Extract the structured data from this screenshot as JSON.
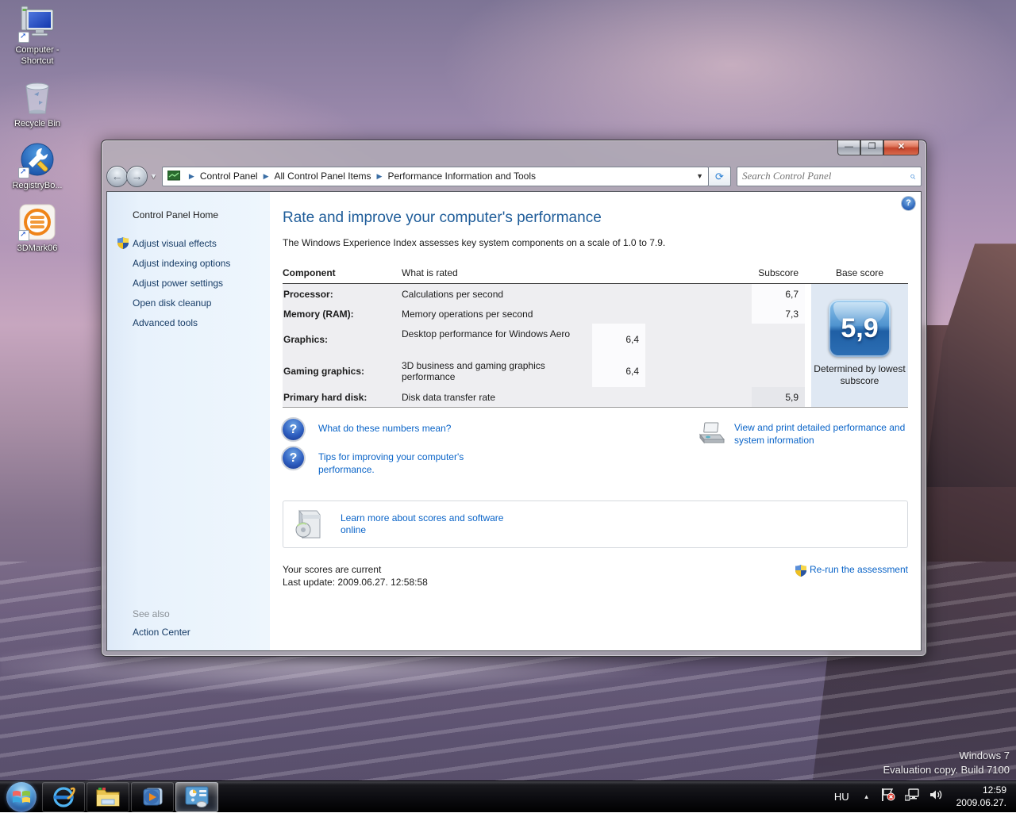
{
  "desktop": {
    "icons": [
      {
        "label": "Computer - Shortcut"
      },
      {
        "label": "Recycle Bin"
      },
      {
        "label": "RegistryBo..."
      },
      {
        "label": "3DMark06"
      }
    ],
    "watermark": {
      "line1": "Windows 7",
      "line2": "Evaluation copy. Build 7100"
    }
  },
  "window": {
    "caption_buttons": {
      "minimize": "—",
      "maximize": "❐",
      "close": "✕"
    },
    "breadcrumb": {
      "item1": "Control Panel",
      "item2": "All Control Panel Items",
      "item3": "Performance Information and Tools"
    },
    "search": {
      "placeholder": "Search Control Panel"
    },
    "sidebar": {
      "home": "Control Panel Home",
      "items": [
        {
          "label": "Adjust visual effects"
        },
        {
          "label": "Adjust indexing options"
        },
        {
          "label": "Adjust power settings"
        },
        {
          "label": "Open disk cleanup"
        },
        {
          "label": "Advanced tools"
        }
      ],
      "see_also": "See also",
      "action_center": "Action Center"
    },
    "main": {
      "title": "Rate and improve your computer's performance",
      "subtitle": "The Windows Experience Index assesses key system components on a scale of 1.0 to 7.9.",
      "table": {
        "headers": {
          "component": "Component",
          "rated": "What is rated",
          "subscore": "Subscore",
          "base": "Base score"
        },
        "rows": [
          {
            "component": "Processor:",
            "rated": "Calculations per second",
            "subscore": "6,7"
          },
          {
            "component": "Memory (RAM):",
            "rated": "Memory operations per second",
            "subscore": "7,3"
          },
          {
            "component": "Graphics:",
            "rated": "Desktop performance for Windows Aero",
            "subscore": "6,4"
          },
          {
            "component": "Gaming graphics:",
            "rated": "3D business and gaming graphics performance",
            "subscore": "6,4"
          },
          {
            "component": "Primary hard disk:",
            "rated": "Disk data transfer rate",
            "subscore": "5,9"
          }
        ]
      },
      "base_score": {
        "value": "5,9",
        "caption": "Determined by lowest subscore"
      },
      "links": {
        "numbers": "What do these numbers mean?",
        "tips": "Tips for improving your computer's performance.",
        "print": "View and print detailed performance and system information",
        "learn": "Learn more about scores and software online",
        "rerun": "Re-run the assessment"
      },
      "status": {
        "current": "Your scores are current",
        "last_update": "Last update: 2009.06.27. 12:58:58"
      },
      "help_glyph": "?"
    }
  },
  "taskbar": {
    "tray": {
      "lang": "HU",
      "time": "12:59",
      "date": "2009.06.27."
    }
  },
  "colors": {
    "title_blue": "#1e5c99",
    "link_blue": "#0a64c8",
    "badge_blue": "#2d6fb4",
    "close_red": "#c4452c"
  }
}
